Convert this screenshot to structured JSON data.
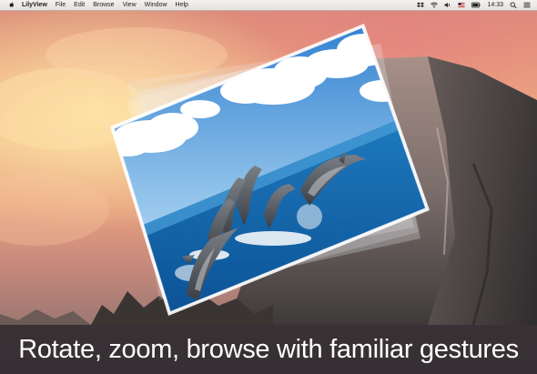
{
  "menubar": {
    "app_name": "LilyView",
    "items": [
      "File",
      "Edit",
      "Browse",
      "View",
      "Window",
      "Help"
    ],
    "clock": "14:33",
    "icons": [
      "apple-logo",
      "dropbox-icon",
      "wifi-icon",
      "volume-icon",
      "flag-icon",
      "battery-icon",
      "search-icon",
      "list-icon"
    ]
  },
  "caption": "Rotate, zoom, browse with familiar gestures"
}
